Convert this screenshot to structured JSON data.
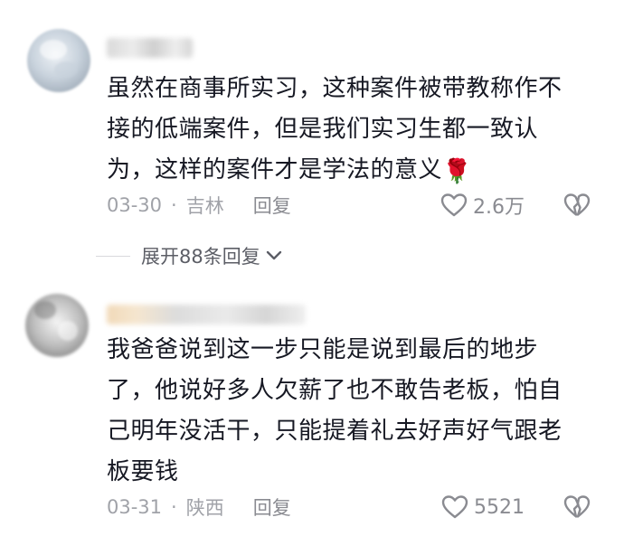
{
  "comments": [
    {
      "text_lines": [
        "虽然在商事所实习，这种案件被带教称作不",
        "接的低端案件，但是我们实习生都一致认",
        "为，这样的案件才是学法的意义"
      ],
      "emoji": "🌹",
      "date": "03-30",
      "location": "吉林",
      "reply_label": "回复",
      "likes": "2.6万"
    },
    {
      "text_lines": [
        "我爸爸说到这一步只能是说到最后的地步",
        "了，他说好多人欠薪了也不敢告老板，怕自",
        "己明年没活干，只能提着礼去好声好气跟老",
        "板要钱"
      ],
      "date": "03-31",
      "location": "陕西",
      "reply_label": "回复",
      "likes": "5521"
    }
  ],
  "expand_replies": {
    "label": "展开88条回复"
  },
  "icons": {
    "like": "heart-outline-icon",
    "dislike": "broken-heart-icon",
    "expand": "chevron-down-icon"
  },
  "colors": {
    "text": "#161823",
    "meta": "#a0a2a8",
    "icon": "#8a8b91"
  }
}
